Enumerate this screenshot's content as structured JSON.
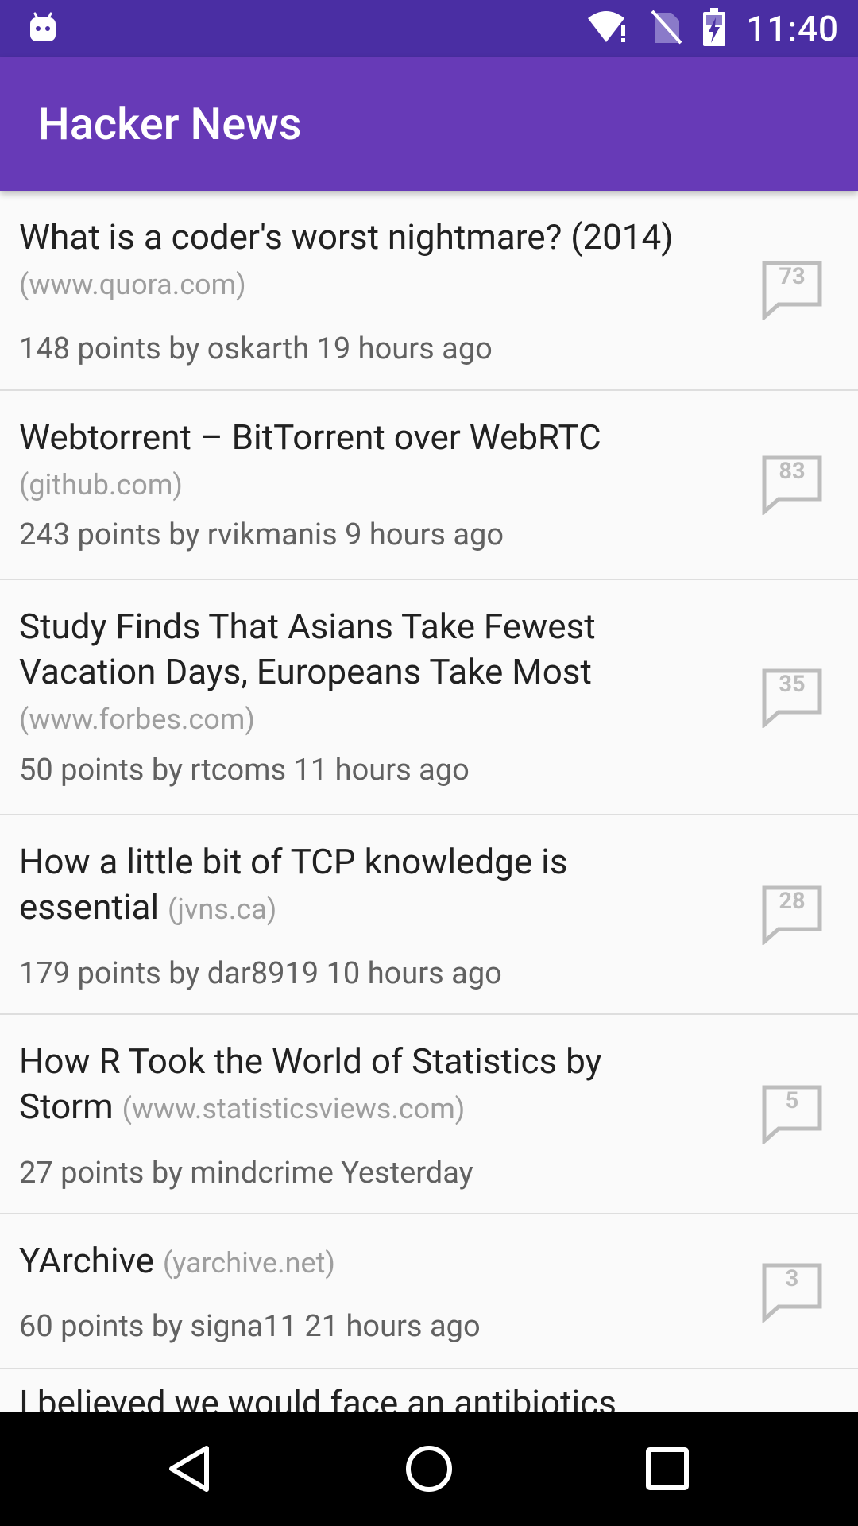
{
  "status_bar": {
    "time": "11:40",
    "left_icon": "android-debug-icon",
    "icons": [
      "wifi-alert-icon",
      "no-sim-icon",
      "battery-charging-icon"
    ]
  },
  "app_bar": {
    "title": "Hacker News"
  },
  "stories": [
    {
      "title": "What is a coder's worst nightmare? (2014)",
      "domain": "(www.quora.com)",
      "meta": "148 points by oskarth 19 hours ago",
      "comments": "73"
    },
    {
      "title": "Webtorrent – BitTorrent over WebRTC",
      "domain": "(github.com)",
      "meta": "243 points by rvikmanis 9 hours ago",
      "comments": "83"
    },
    {
      "title": "Study Finds That Asians Take Fewest Vacation Days, Europeans Take Most",
      "domain": "(www.forbes.com)",
      "meta": "50 points by rtcoms 11 hours ago",
      "comments": "35"
    },
    {
      "title": "How a little bit of TCP knowledge is essential",
      "domain": "(jvns.ca)",
      "meta": "179 points by dar8919 10 hours ago",
      "comments": "28"
    },
    {
      "title": "How R Took the World of Statistics by Storm",
      "domain": "(www.statisticsviews.com)",
      "meta": "27 points by mindcrime Yesterday",
      "comments": "5"
    },
    {
      "title": "YArchive",
      "domain": "(yarchive.net)",
      "meta": "60 points by signa11 21 hours ago",
      "comments": "3"
    },
    {
      "title": "I believed we would face an antibiotics",
      "domain": "",
      "meta": "",
      "comments": ""
    }
  ],
  "nav_bar": {
    "icons": [
      "back-icon",
      "home-icon",
      "recents-icon"
    ]
  },
  "colors": {
    "status_bar": "#4a2ea3",
    "app_bar": "#673ab7",
    "accent_gray": "#bdbdbd"
  }
}
